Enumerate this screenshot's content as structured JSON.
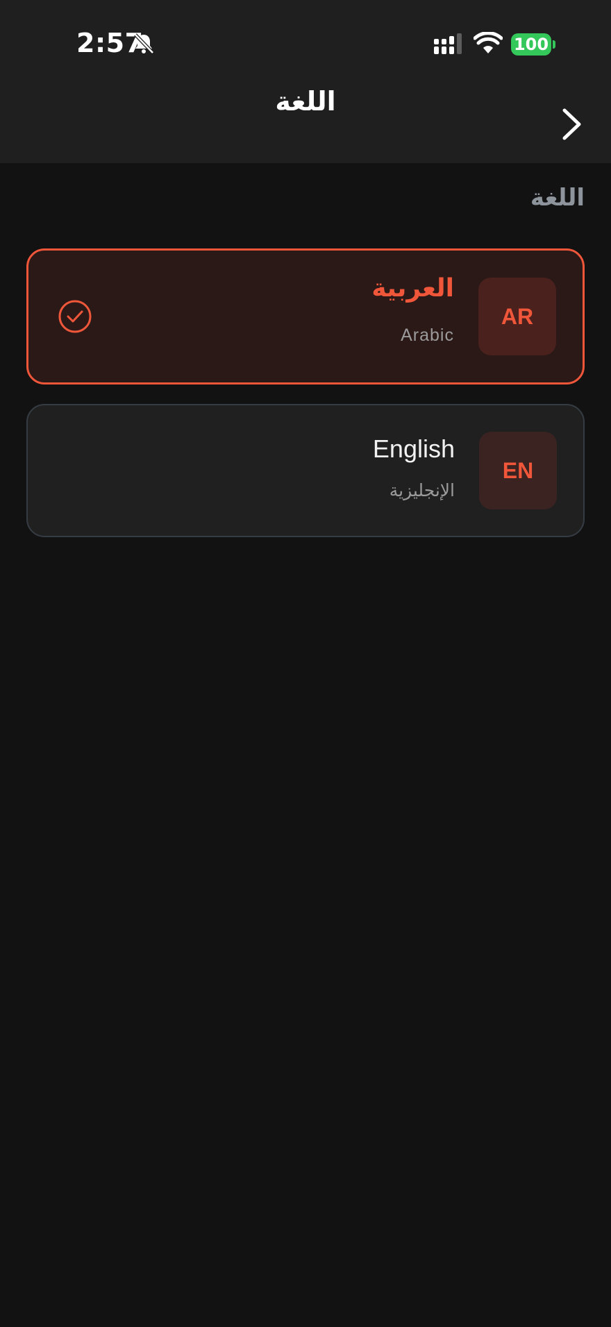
{
  "status_bar": {
    "time": "2:57",
    "battery": "100",
    "icons": [
      "bell-slash-icon",
      "cellular-signal-icon",
      "wifi-icon",
      "battery-icon"
    ]
  },
  "nav": {
    "title": "اللغة",
    "back_icon": "chevron-right-icon"
  },
  "section": {
    "heading": "اللغة"
  },
  "languages": [
    {
      "code": "AR",
      "name": "العربية",
      "subtitle": "Arabic",
      "selected": true
    },
    {
      "code": "EN",
      "name": "English",
      "subtitle": "الإنجليزية",
      "selected": false
    }
  ],
  "colors": {
    "accent": "#f0573a",
    "background": "#121212",
    "header": "#1f1f1f",
    "battery": "#34c759"
  }
}
